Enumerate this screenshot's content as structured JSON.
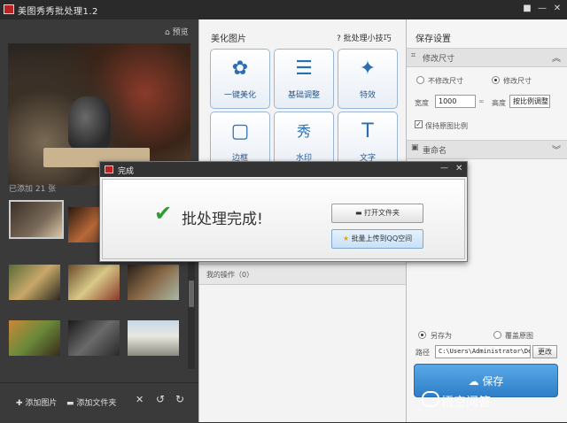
{
  "window": {
    "title": "美图秀秀批处理1.2",
    "controls": [
      "■",
      "—",
      "✕"
    ]
  },
  "left": {
    "preview_label": "预览",
    "added_count": "已添加 21 张",
    "bottom": {
      "add_image": "添加图片",
      "add_folder": "添加文件夹"
    }
  },
  "middle": {
    "title": "美化图片",
    "tips": "批处理小技巧",
    "tiles": [
      "一键美化",
      "基础调整",
      "特效",
      "边框",
      "水印",
      "文字"
    ],
    "ops_label": "我的操作（0）"
  },
  "right": {
    "title": "保存设置",
    "resize_section": "修改尺寸",
    "no_resize": "不修改尺寸",
    "resize": "修改尺寸",
    "width_label": "宽度",
    "width_value": "1000",
    "height_label": "高度",
    "height_value": "按比例调整",
    "keep_ratio": "保持原图比例",
    "rename_section": "重命名",
    "save_as": "另存为",
    "overwrite": "覆盖原图",
    "path_label": "路径",
    "path_value": "C:\\Users\\Administrator\\De:",
    "change_label": "更改",
    "save_label": "保存"
  },
  "dialog": {
    "title": "完成",
    "message": "批处理完成!",
    "open_folder": "打开文件夹",
    "upload": "批量上传到QQ空间"
  },
  "watermark": "悟空问答",
  "colors": {
    "accent_blue": "#2d7ec8",
    "success_green": "#2e9c2e",
    "dark_bg": "#3a3a3a"
  }
}
